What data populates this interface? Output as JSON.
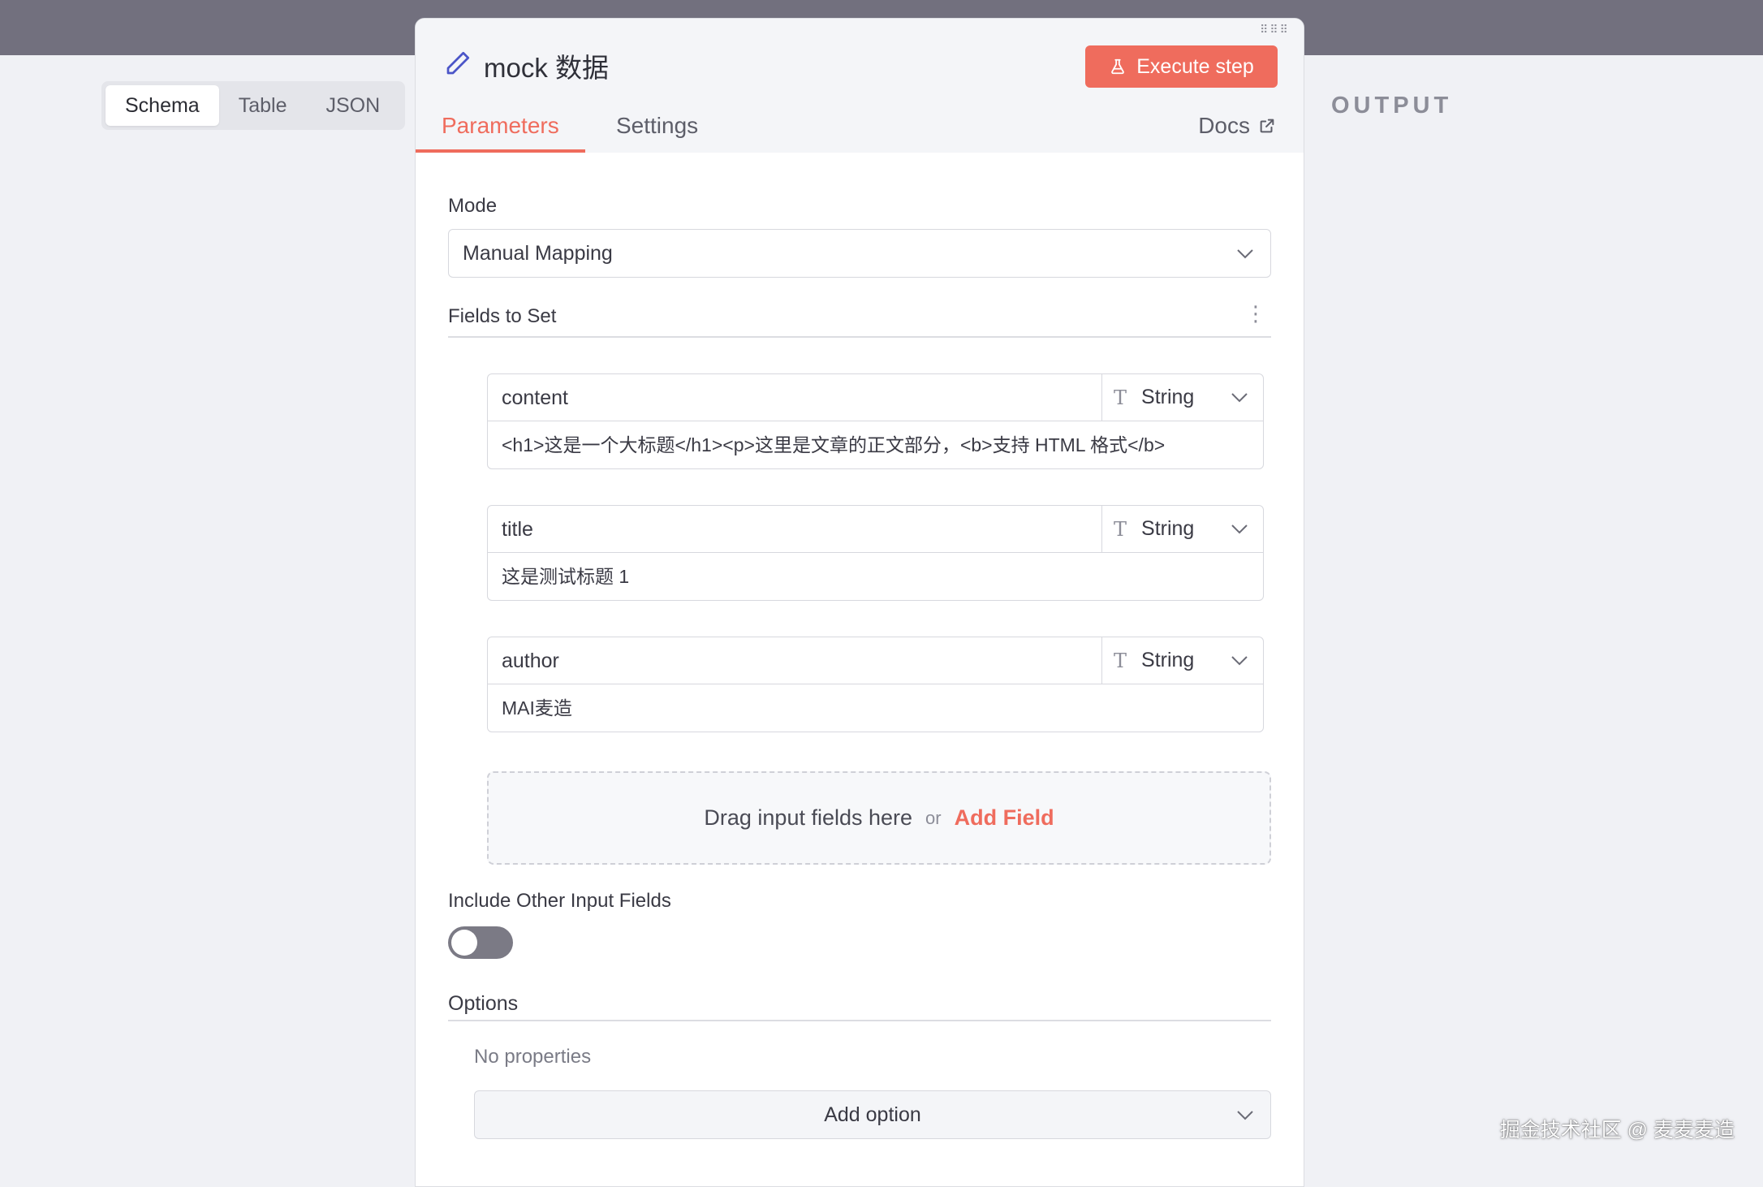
{
  "view_toggle": {
    "schema": "Schema",
    "table": "Table",
    "json": "JSON"
  },
  "output_label": "OUTPUT",
  "panel": {
    "title": "mock 数据",
    "execute_label": "Execute step",
    "tabs": {
      "parameters": "Parameters",
      "settings": "Settings"
    },
    "docs_label": "Docs"
  },
  "mode": {
    "label": "Mode",
    "value": "Manual Mapping"
  },
  "fields_to_set": {
    "label": "Fields to Set",
    "menu_glyph": "⋮",
    "items": [
      {
        "name": "content",
        "type": "String",
        "value": "<h1>这是一个大标题</h1><p>这里是文章的正文部分，<b>支持 HTML 格式</b>"
      },
      {
        "name": "title",
        "type": "String",
        "value": "这是测试标题 1"
      },
      {
        "name": "author",
        "type": "String",
        "value": "MAI麦造"
      }
    ],
    "type_glyph": "T"
  },
  "dropzone": {
    "text": "Drag input fields here",
    "or": "or",
    "add_field": "Add Field"
  },
  "include_other": {
    "label": "Include Other Input Fields",
    "enabled": false
  },
  "options": {
    "label": "Options",
    "empty": "No properties",
    "add_option": "Add option"
  },
  "watermark": "掘金技术社区 @ 麦麦麦造",
  "colors": {
    "accent": "#ef6c5d",
    "topbar": "#72707e",
    "background": "#f0f1f5"
  },
  "icons": [
    "pencil-icon",
    "flask-icon",
    "external-link-icon",
    "chevron-down-icon",
    "kebab-menu-icon",
    "text-type-icon",
    "drag-handle-icon"
  ]
}
